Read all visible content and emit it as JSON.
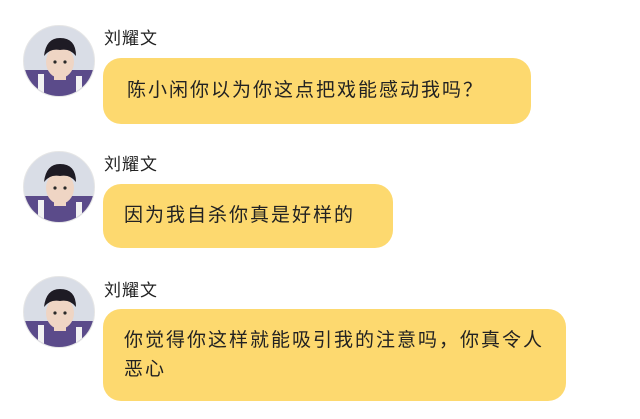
{
  "messages": [
    {
      "sender": "刘耀文",
      "avatar_icon": "user-avatar-icon",
      "text": "陈小闲你以为你这点把戏能感动我吗？"
    },
    {
      "sender": "刘耀文",
      "avatar_icon": "user-avatar-icon",
      "text": "因为我自杀你真是好样的"
    },
    {
      "sender": "刘耀文",
      "avatar_icon": "user-avatar-icon",
      "text": "你觉得你这样就能吸引我的注意吗，你真令人恶心"
    }
  ],
  "colors": {
    "bubble": "#fdd96f",
    "text": "#222222",
    "background": "#ffffff"
  }
}
